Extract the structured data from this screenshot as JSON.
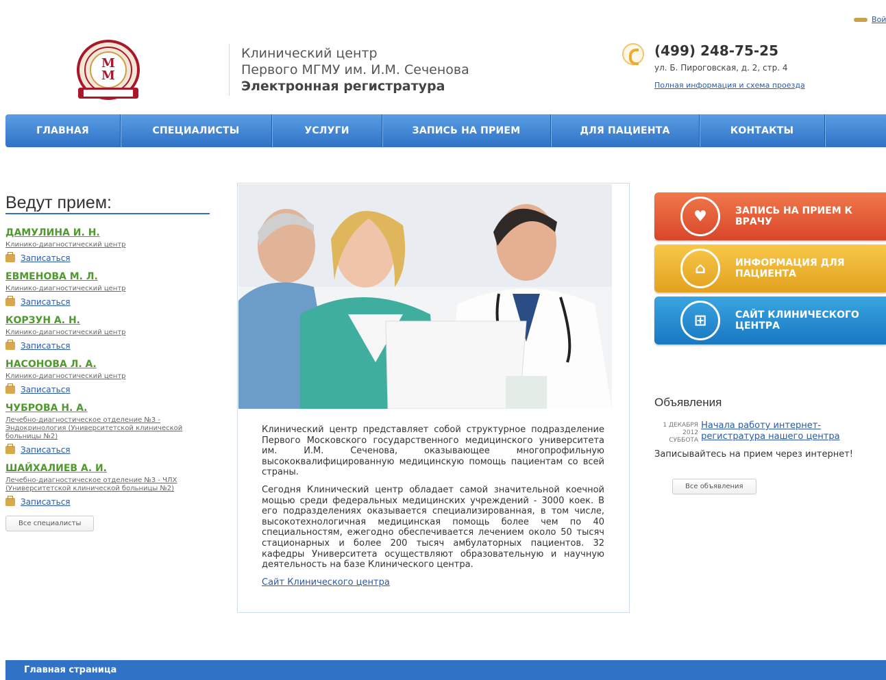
{
  "header": {
    "login_text": "Вой",
    "brand_line1": "Клинический центр",
    "brand_line2": "Первого МГМУ им. И.М. Сеченова",
    "brand_line3": "Электронная регистратура",
    "phone": "(499) 248-75-25",
    "address": "ул. Б. Пироговская, д. 2, стр. 4",
    "info_link": "Полная информация и схема проезда"
  },
  "nav": [
    "ГЛАВНАЯ",
    "СПЕЦИАЛИСТЫ",
    "УСЛУГИ",
    "ЗАПИСЬ НА ПРИЕМ",
    "ДЛЯ ПАЦИЕНТА",
    "КОНТАКТЫ"
  ],
  "left": {
    "title": "Ведут прием:",
    "book_label": "Записаться",
    "all_button": "Все специалисты",
    "doctors": [
      {
        "name": "ДАМУЛИНА И. Н.",
        "dept": "Клинико-диагностический центр"
      },
      {
        "name": "ЕВМЕНОВА М. Л.",
        "dept": "Клинико-диагностический центр"
      },
      {
        "name": "КОРЗУН А. Н.",
        "dept": "Клинико-диагностический центр"
      },
      {
        "name": "НАСОНОВА Л. А.",
        "dept": "Клинико-диагностический центр"
      },
      {
        "name": "ЧУБРОВА Н. А.",
        "dept": "Лечебно-диагностическое отделение №3 - Эндокринология (Университетской клинической больницы №2)"
      },
      {
        "name": "ШАЙХАЛИЕВ А. И.",
        "dept": "Лечебно-диагностическое отделение №3 - ЧЛХ (Университетской клинической больницы №2)"
      }
    ]
  },
  "center": {
    "para1": "Клинический центр представляет собой структурное подразделение Первого Московского государственного медицинского университета им. И.М. Сеченова, оказывающее многопрофильную высококвалифицированную медицинскую помощь пациентам со всей страны.",
    "para2": "Сегодня Клинический центр обладает самой значительной коечной мощью среди федеральных медицинских учреждений - 3000 коек. В его подразделениях оказывается специализированная, в том числе, высокотехнологичная медицинская помощь более чем по 40 специальностям, ежегодно обеспечивается лечением около 50 тысяч стационарных и более 200 тысяч амбулаторных пациентов. 32 кафедры Университета осуществляют образовательную и научную деятельность на базе Клинического центра.",
    "link": "Сайт Клинического центра"
  },
  "promos": {
    "p1": "ЗАПИСЬ НА ПРИЕМ К ВРАЧУ",
    "p2": "ИНФОРМАЦИЯ ДЛЯ ПАЦИЕНТА",
    "p3": "САЙТ КЛИНИЧЕСКОГО ЦЕНТРА"
  },
  "news": {
    "title": "Объявления",
    "date_line1": "1 ДЕКАБРЯ 2012",
    "date_line2": "СУББОТА",
    "link": "Начала работу интернет-регистратура нашего центра",
    "text": "Записывайтесь на прием через интернет!",
    "all_button": "Все объявления"
  },
  "footer": {
    "label": "Главная страница"
  },
  "colors": {
    "nav_blue": "#2f72c6",
    "doctor_green": "#4f9a2c",
    "promo_red": "#e05a36",
    "promo_yellow": "#eeb22c",
    "promo_blue": "#2590d4"
  }
}
